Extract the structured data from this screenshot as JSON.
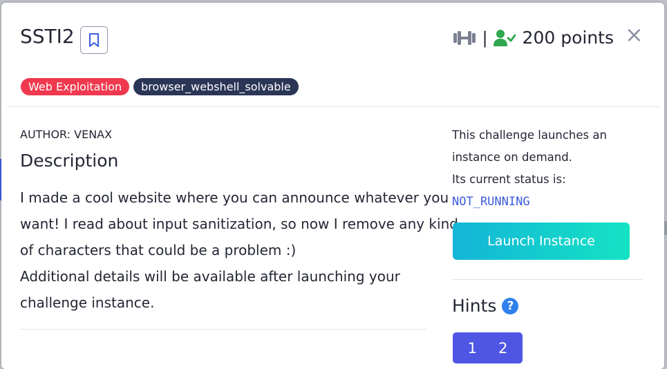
{
  "modal": {
    "title": "SSTI2",
    "points": "200 points",
    "separator": "|",
    "close_symbol": "×"
  },
  "tags": [
    {
      "label": "Web Exploitation",
      "color": "#f0394f"
    },
    {
      "label": "browser_webshell_solvable",
      "color": "#2b3656"
    }
  ],
  "author": "AUTHOR: VENAX",
  "description": {
    "heading": "Description",
    "lines": [
      "I made a cool website where you can announce whatever you",
      "want! I read about input sanitization, so now I remove any kind",
      "of characters that could be a problem :)",
      "Additional details will be available after launching your",
      "challenge instance."
    ]
  },
  "instance": {
    "line1": "This challenge launches an",
    "line2": "instance on demand.",
    "line3": "Its current status is:",
    "status": "NOT_RUNNING",
    "launch_label": "Launch Instance"
  },
  "hints": {
    "heading": "Hints",
    "help_symbol": "?",
    "items": [
      "1",
      "2"
    ]
  },
  "colors": {
    "accent_blue": "#3b5bdb",
    "tag_red": "#f0394f",
    "tag_navy": "#2b3656",
    "launch_gradient_start": "#13b5d8",
    "launch_gradient_end": "#14e3c3",
    "solved_green": "#2fa84f",
    "hint_purple": "#4f56e3"
  },
  "icons": {
    "bookmark": "bookmark-icon",
    "difficulty": "dumbbell-icon",
    "solved": "user-check-icon",
    "close": "close-icon",
    "help": "question-circle-icon"
  }
}
